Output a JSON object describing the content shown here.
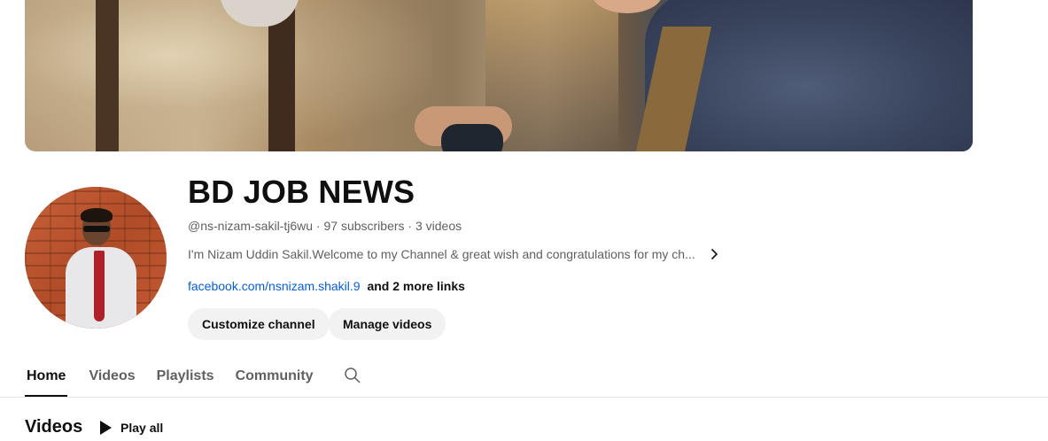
{
  "channel": {
    "name": "BD JOB NEWS",
    "handle": "@ns-nizam-sakil-tj6wu",
    "subscribers": "97 subscribers",
    "videos_count": "3 videos",
    "meta_line": "@ns-nizam-sakil-tj6wu · 97 subscribers · 3 videos",
    "description": "I'm Nizam Uddin Sakil.Welcome to my Channel & great wish and congratulations for my ch...",
    "link": "facebook.com/nsnizam.shakil.9",
    "more_links": "and 2 more links"
  },
  "buttons": {
    "customize": "Customize channel",
    "manage": "Manage videos"
  },
  "tabs": [
    {
      "label": "Home",
      "active": true
    },
    {
      "label": "Videos",
      "active": false
    },
    {
      "label": "Playlists",
      "active": false
    },
    {
      "label": "Community",
      "active": false
    }
  ],
  "section": {
    "title": "Videos",
    "play_all": "Play all"
  },
  "icons": {
    "description_expand": "chevron-right-icon",
    "tab_search": "search-icon",
    "play_all": "play-icon"
  },
  "colors": {
    "link": "#065fd4",
    "text_primary": "#0f0f0f",
    "text_secondary": "#606060",
    "button_bg": "#f2f2f2"
  }
}
